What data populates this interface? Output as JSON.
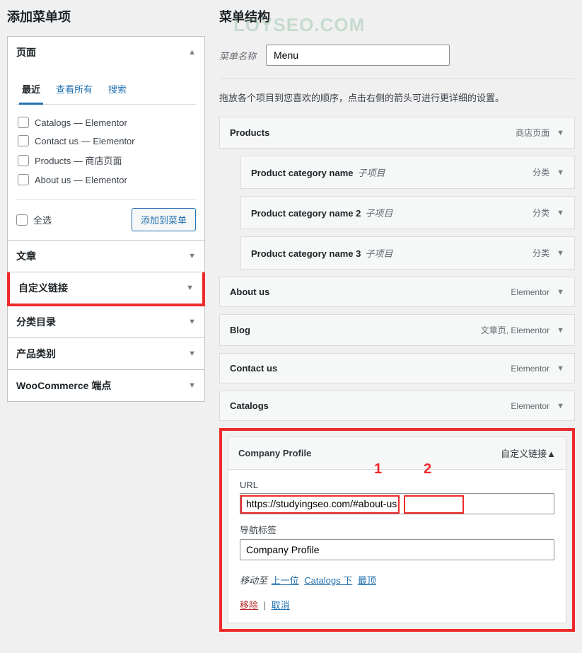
{
  "watermark": "LOYSEO.COM",
  "left": {
    "title": "添加菜单项",
    "pages": {
      "header": "页面",
      "tabs": {
        "recent": "最近",
        "all": "查看所有",
        "search": "搜索"
      },
      "items": [
        {
          "label": "Catalogs — Elementor"
        },
        {
          "label": "Contact us — Elementor"
        },
        {
          "label": "Products — 商店页面"
        },
        {
          "label": "About us — Elementor"
        }
      ],
      "select_all": "全选",
      "add_btn": "添加到菜单"
    },
    "sections": {
      "posts": "文章",
      "custom_links": "自定义链接",
      "categories": "分类目录",
      "product_cat": "产品类别",
      "woo": "WooCommerce 端点"
    }
  },
  "right": {
    "title": "菜单结构",
    "menu_name_label": "菜单名称",
    "menu_name_value": "Menu",
    "instructions": "拖放各个项目到您喜欢的顺序，点击右侧的箭头可进行更详细的设置。",
    "items": {
      "products": {
        "label": "Products",
        "meta": "商店页面"
      },
      "cat1": {
        "label": "Product category name",
        "sub": "子项目",
        "meta": "分类"
      },
      "cat2": {
        "label": "Product category name 2",
        "sub": "子项目",
        "meta": "分类"
      },
      "cat3": {
        "label": "Product category name 3",
        "sub": "子项目",
        "meta": "分类"
      },
      "about": {
        "label": "About us",
        "meta": "Elementor"
      },
      "blog": {
        "label": "Blog",
        "meta": "文章页, Elementor"
      },
      "contact": {
        "label": "Contact us",
        "meta": "Elementor"
      },
      "catalogs": {
        "label": "Catalogs",
        "meta": "Elementor"
      },
      "company": {
        "label": "Company Profile",
        "meta": "自定义链接",
        "url_label": "URL",
        "url_value": "https://studyingseo.com/#about-us",
        "nav_label_label": "导航标签",
        "nav_label_value": "Company Profile",
        "move_label": "移动至",
        "move_prev": "上一位",
        "move_under": "Catalogs 下",
        "move_top": "最顶",
        "remove": "移除",
        "cancel": "取消",
        "num1": "1",
        "num2": "2"
      }
    }
  }
}
